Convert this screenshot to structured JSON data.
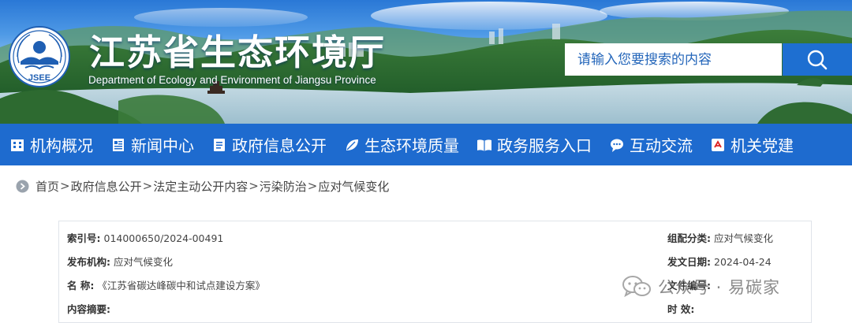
{
  "header": {
    "title": "江苏省生态环境厅",
    "subtitle": "Department of Ecology and Environment of Jiangsu Province",
    "logo_text": "JSEE",
    "search": {
      "placeholder": "请输入您要搜索的内容",
      "button_icon": "search-icon"
    }
  },
  "nav": {
    "items": [
      {
        "label": "机构概况",
        "icon": "building-icon"
      },
      {
        "label": "新闻中心",
        "icon": "newspaper-icon"
      },
      {
        "label": "政府信息公开",
        "icon": "document-icon"
      },
      {
        "label": "生态环境质量",
        "icon": "leaf-icon"
      },
      {
        "label": "政务服务入口",
        "icon": "service-book-icon"
      },
      {
        "label": "互动交流",
        "icon": "chat-icon"
      },
      {
        "label": "机关党建",
        "icon": "party-flag-icon"
      }
    ]
  },
  "breadcrumb": {
    "icon": "location-pin-icon",
    "items": [
      "首页",
      "政府信息公开",
      "法定主动公开内容",
      "污染防治",
      "应对气候变化"
    ],
    "separator": ">"
  },
  "info": {
    "index_label": "索引号:",
    "index_value": "014000650/2024-00491",
    "category_label": "组配分类:",
    "category_value": "应对气候变化",
    "publisher_label": "发布机构:",
    "publisher_value": "应对气候变化",
    "date_label": "发文日期:",
    "date_value": "2024-04-24",
    "name_label": "名 称:",
    "name_value": "《江苏省碳达峰碳中和试点建设方案》",
    "docno_label": "文件编号:",
    "docno_value": "",
    "summary_label": "内容摘要:",
    "summary_value": "",
    "effect_label": "时 效:",
    "effect_value": ""
  },
  "watermark": {
    "text": "公众号 · 易碳家",
    "icon": "wechat-icon"
  },
  "colors": {
    "nav_bg": "#1e6bcf",
    "search_btn": "#1e6fd1",
    "search_text": "#2466ba"
  }
}
